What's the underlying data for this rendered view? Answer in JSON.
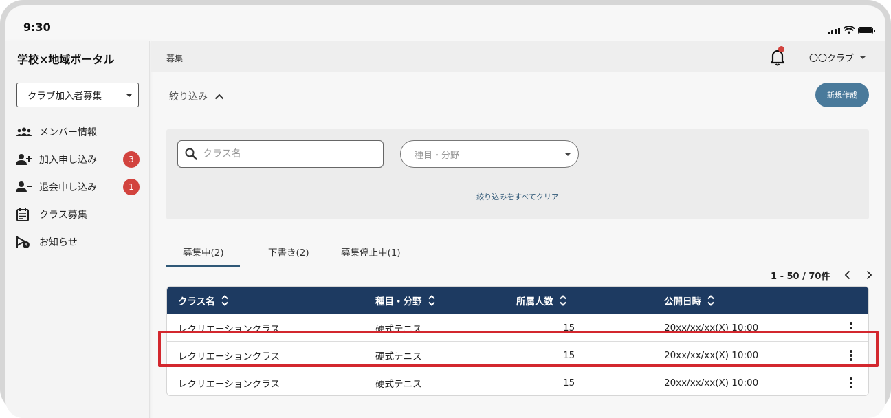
{
  "status_bar": {
    "time": "9:30"
  },
  "sidebar": {
    "app_title": "学校×地域ポータル",
    "context_select": "クラブ加入者募集",
    "items": [
      {
        "label": "メンバー情報",
        "icon": "members-icon",
        "badge": null
      },
      {
        "label": "加入申し込み",
        "icon": "person-add-icon",
        "badge": "3"
      },
      {
        "label": "退会申し込み",
        "icon": "person-remove-icon",
        "badge": "1"
      },
      {
        "label": "クラス募集",
        "icon": "calendar-list-icon",
        "badge": null
      },
      {
        "label": "お知らせ",
        "icon": "announcement-icon",
        "badge": null
      }
    ]
  },
  "header": {
    "breadcrumb": "募集",
    "user": "〇〇クラブ",
    "notification_dot": true
  },
  "filter": {
    "toggle_label": "絞り込み",
    "new_button": "新規作成",
    "search_placeholder": "クラス名",
    "category_placeholder": "種目・分野",
    "clear_label": "絞り込みをすべてクリア"
  },
  "tabs": [
    {
      "label": "募集中(2)",
      "active": true
    },
    {
      "label": "下書き(2)",
      "active": false
    },
    {
      "label": "募集停止中(1)",
      "active": false
    }
  ],
  "pagination": {
    "range": "1 - 50 / 70件"
  },
  "table": {
    "headers": [
      "クラス名",
      "種目・分野",
      "所属人数",
      "公開日時"
    ],
    "rows": [
      {
        "name": "レクリエーションクラス",
        "category": "硬式テニス",
        "members": "15",
        "published": "20xx/xx/xx(X) 10:00"
      },
      {
        "name": "レクリエーションクラス",
        "category": "硬式テニス",
        "members": "15",
        "published": "20xx/xx/xx(X) 10:00"
      },
      {
        "name": "レクリエーションクラス",
        "category": "硬式テニス",
        "members": "15",
        "published": "20xx/xx/xx(X) 10:00"
      }
    ]
  },
  "colors": {
    "table_header": "#1d3a61",
    "primary_button": "#4a7a9b",
    "badge": "#d2433e",
    "highlight": "#d3272e"
  }
}
